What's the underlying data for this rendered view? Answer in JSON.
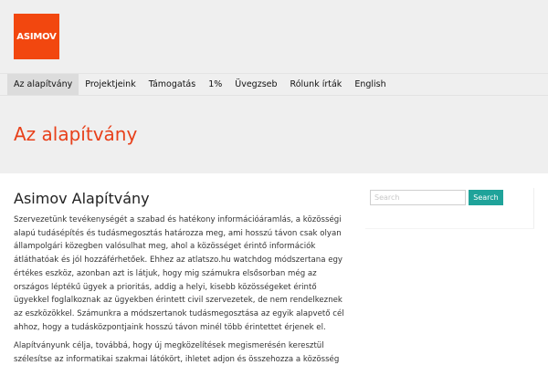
{
  "header": {
    "logo_text": "ASIMOV"
  },
  "nav": {
    "items": [
      {
        "label": "Az alapítvány",
        "active": true
      },
      {
        "label": "Projektjeink"
      },
      {
        "label": "Támogatás"
      },
      {
        "label": "1%"
      },
      {
        "label": "Üvegzseb"
      },
      {
        "label": "Rólunk írták"
      },
      {
        "label": "English"
      }
    ]
  },
  "page": {
    "title": "Az alapítvány"
  },
  "article": {
    "heading": "Asimov Alapítvány",
    "paragraphs": [
      "Szervezetünk tevékenységét a szabad és hatékony információáramlás, a közösségi alapú tudásépítés és tudásmegosztás határozza meg, ami hosszú távon csak olyan állampolgári közegben valósulhat meg, ahol a közösséget érintő információk átláthatóak és jól hozzáférhetőek. Ehhez az atlatszo.hu watchdog módszertana egy értékes eszköz, azonban azt is látjuk, hogy mig számukra elsősorban még az országos léptékű ügyek a prioritás, addig a helyi, kisebb közösségeket érintő ügyekkel foglalkoznak az ügyekben érintett civil szervezetek, de nem rendelkeznek az eszközökkel. Számunkra a módszertanok tudásmegosztása az egyik alapvető cél ahhoz, hogy a tudásközpontjaink hosszú távon minél több érintettet érjenek el.",
      "Alapítványunk célja, továbbá, hogy új megközelítések megismerésén keresztül szélesítse az informatikai szakmai látókört, ihletet adjon és összehozza a közösség"
    ]
  },
  "sidebar": {
    "search_placeholder": "Search",
    "search_button": "Search"
  },
  "colors": {
    "accent": "#e8401a",
    "logo_bg": "#f2470f",
    "button": "#1fa39a",
    "band": "#efefef"
  }
}
